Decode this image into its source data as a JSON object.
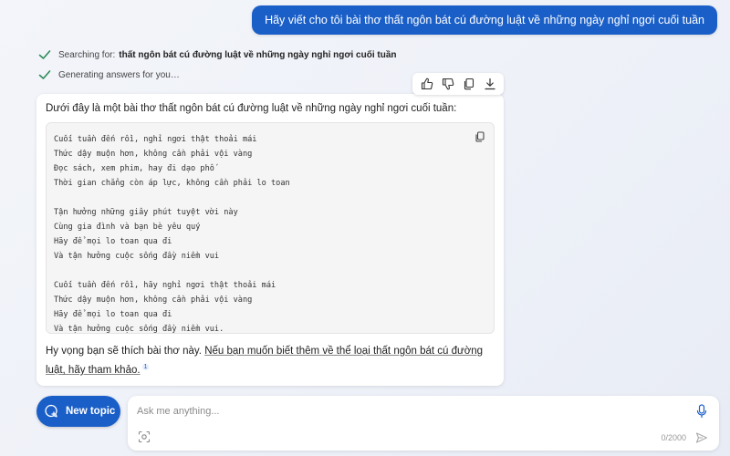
{
  "user_message": "Hãy viết cho tôi bài thơ thất ngôn bát cú đường luật về những ngày nghỉ ngơi cuối tuần",
  "status": {
    "searching_prefix": "Searching for:",
    "searching_query": "thất ngôn bát cú đường luật về những ngày nghỉ ngơi cuối tuần",
    "generating": "Generating answers for you…"
  },
  "answer": {
    "intro": "Dưới đây là một bài thơ thất ngôn bát cú đường luật về những ngày nghỉ ngơi cuối tuần:",
    "poem": {
      "stanza1": [
        "Cuối tuần đến rồi, nghỉ ngơi thật thoải mái",
        "Thức dậy muộn hơn, không cần phải vội vàng",
        "Đọc sách, xem phim, hay đi dạo phố",
        "Thời gian chẳng còn áp lực, không cần phải lo toan"
      ],
      "stanza2": [
        "Tận hưởng những giây phút tuyệt vời này",
        "Cùng gia đình và bạn bè yêu quý",
        "Hãy để mọi lo toan qua đi",
        "Và tận hưởng cuộc sống đầy niềm vui"
      ],
      "stanza3": [
        "Cuối tuần đến rồi, hãy nghỉ ngơi thật thoải mái",
        "Thức dậy muộn hơn, không cần phải vội vàng",
        "Hãy để mọi lo toan qua đi",
        "Và tận hưởng cuộc sống đầy niềm vui."
      ]
    },
    "outro_plain": "Hy vọng bạn sẽ thích bài thơ này. ",
    "outro_link": "Nếu bạn muốn biết thêm về thể loại thất ngôn bát cú đường luật, hãy tham khảo.",
    "citation": "1"
  },
  "new_topic_label": "New topic",
  "composer": {
    "placeholder": "Ask me anything...",
    "counter": "0/2000"
  },
  "icons": {
    "check": "check-icon",
    "thumbs_up": "thumbs-up-icon",
    "thumbs_down": "thumbs-down-icon",
    "copy": "copy-icon",
    "download": "download-icon",
    "new_topic": "chat-plus-icon",
    "mic": "mic-icon",
    "image": "image-search-icon",
    "send": "send-icon"
  },
  "colors": {
    "accent": "#1a5fc8",
    "check": "#2e8b57"
  }
}
